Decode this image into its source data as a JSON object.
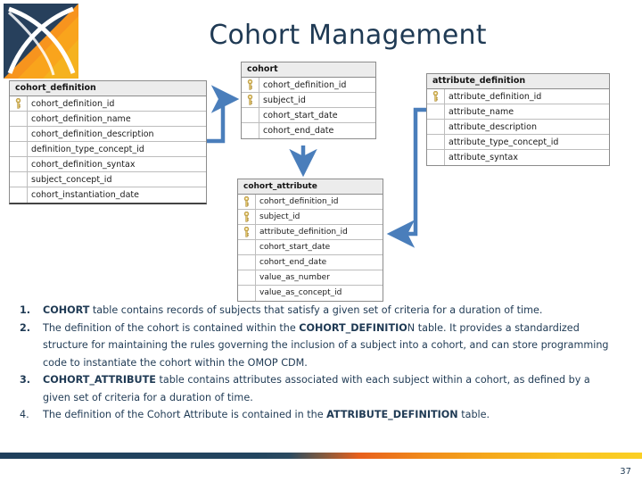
{
  "slide": {
    "title": "Cohort Management",
    "page_number": "37",
    "logo_name": "ohdsi-logo",
    "colors": {
      "title_navy": "#1f3a54",
      "logo_navy": "#27405c",
      "logo_orange": "#f7941e",
      "logo_amber": "#fbb040",
      "arrow_blue": "#4a7ebb",
      "table_header_gray": "#ececec",
      "key_gold": "#e0c061",
      "bar_gradient_start": "#1f3f5c",
      "bar_gradient_end": "#fbd024"
    }
  },
  "diagram": {
    "tables": [
      {
        "name": "cohort_definition",
        "fields": [
          {
            "label": "cohort_definition_id",
            "key": true
          },
          {
            "label": "cohort_definition_name",
            "key": false
          },
          {
            "label": "cohort_definition_description",
            "key": false
          },
          {
            "label": "definition_type_concept_id",
            "key": false
          },
          {
            "label": "cohort_definition_syntax",
            "key": false
          },
          {
            "label": "subject_concept_id",
            "key": false
          },
          {
            "label": "cohort_instantiation_date",
            "key": false
          }
        ]
      },
      {
        "name": "cohort",
        "fields": [
          {
            "label": "cohort_definition_id",
            "key": true
          },
          {
            "label": "subject_id",
            "key": true
          },
          {
            "label": "cohort_start_date",
            "key": false
          },
          {
            "label": "cohort_end_date",
            "key": false
          }
        ]
      },
      {
        "name": "cohort_attribute",
        "fields": [
          {
            "label": "cohort_definition_id",
            "key": true
          },
          {
            "label": "subject_id",
            "key": true
          },
          {
            "label": "attribute_definition_id",
            "key": true
          },
          {
            "label": "cohort_start_date",
            "key": false
          },
          {
            "label": "cohort_end_date",
            "key": false
          },
          {
            "label": "value_as_number",
            "key": false
          },
          {
            "label": "value_as_concept_id",
            "key": false
          }
        ]
      },
      {
        "name": "attribute_definition",
        "fields": [
          {
            "label": "attribute_definition_id",
            "key": true
          },
          {
            "label": "attribute_name",
            "key": false
          },
          {
            "label": "attribute_description",
            "key": false
          },
          {
            "label": "attribute_type_concept_id",
            "key": false
          },
          {
            "label": "attribute_syntax",
            "key": false
          }
        ]
      }
    ],
    "relations": [
      {
        "name": "cohort_definition-to-cohort",
        "from": "cohort_definition",
        "to": "cohort"
      },
      {
        "name": "cohort-to-cohort_attribute",
        "from": "cohort",
        "to": "cohort_attribute"
      },
      {
        "name": "attribute_definition-to-cohort_attribute",
        "from": "attribute_definition",
        "to": "cohort_attribute"
      }
    ]
  },
  "notes": [
    {
      "number": "1.",
      "bold_number": true,
      "segments": [
        {
          "text": "COHORT",
          "bold": true
        },
        {
          "text": " table contains records of subjects that satisfy a given set of criteria for a duration of time.",
          "bold": false
        }
      ]
    },
    {
      "number": "2.",
      "bold_number": true,
      "segments": [
        {
          "text": "The definition of the cohort is contained within the ",
          "bold": false
        },
        {
          "text": "COHORT_DEFINITIO",
          "bold": true
        },
        {
          "text": "N table. It provides a standardized structure for maintaining the rules governing the inclusion of a subject into a cohort, and can store programming code to instantiate the cohort within the OMOP CDM.",
          "bold": false
        }
      ]
    },
    {
      "number": "3.",
      "bold_number": true,
      "segments": [
        {
          "text": "COHORT_ATTRIBUTE",
          "bold": true
        },
        {
          "text": " table contains attributes associated with each subject within a cohort, as defined by a given set of criteria for a duration of time.",
          "bold": false
        }
      ]
    },
    {
      "number": "4.",
      "bold_number": false,
      "segments": [
        {
          "text": "The definition of the Cohort Attribute is contained in the ",
          "bold": false
        },
        {
          "text": "ATTRIBUTE_DEFINITION",
          "bold": true
        },
        {
          "text": " table.",
          "bold": false
        }
      ]
    }
  ]
}
